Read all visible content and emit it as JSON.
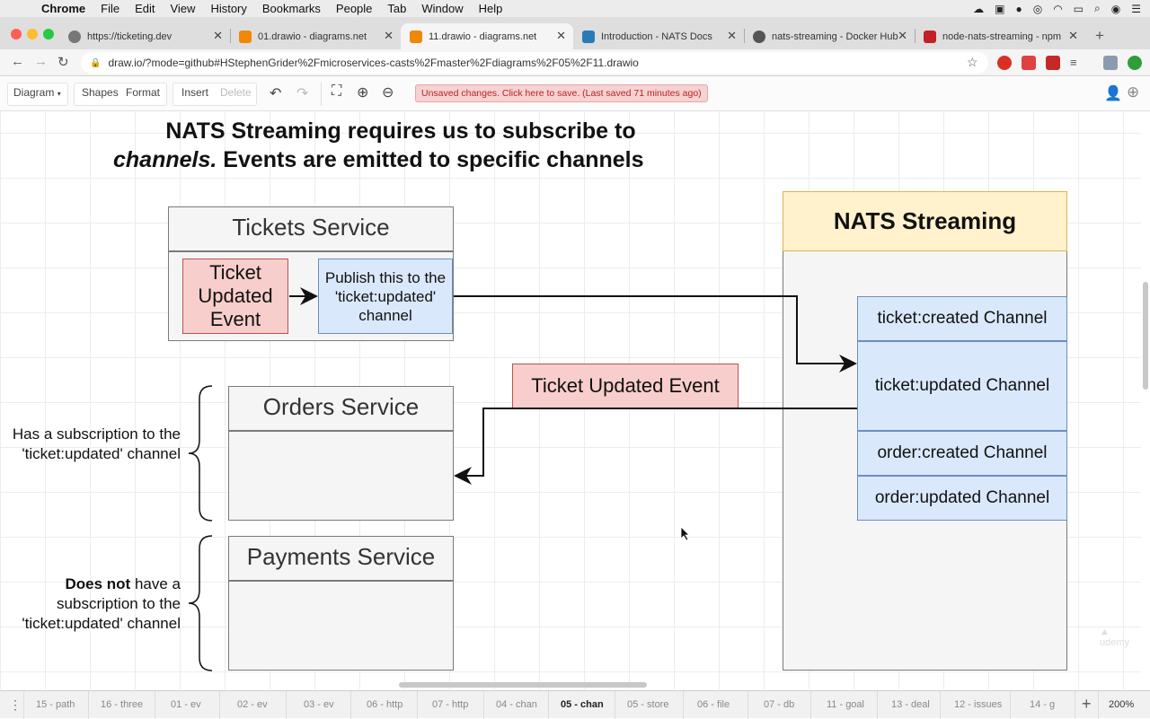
{
  "menubar": {
    "apple": "",
    "items": [
      "Chrome",
      "File",
      "Edit",
      "View",
      "History",
      "Bookmarks",
      "People",
      "Tab",
      "Window",
      "Help"
    ]
  },
  "tabs": [
    {
      "title": "https://ticketing.dev",
      "color": "#666666"
    },
    {
      "title": "01.drawio - diagrams.net",
      "color": "#f08705"
    },
    {
      "title": "11.drawio - diagrams.net",
      "color": "#f08705"
    },
    {
      "title": "Introduction - NATS Docs",
      "color": "#2a7ab8"
    },
    {
      "title": "nats-streaming - Docker Hub",
      "color": "#555555"
    },
    {
      "title": "node-nats-streaming - npm",
      "color": "#c12127"
    }
  ],
  "address": {
    "url": "draw.io/?mode=github#HStephenGrider%2Fmicroservices-casts%2Fmaster%2Fdiagrams%2F05%2F11.drawio"
  },
  "toolbar": {
    "diagram": "Diagram",
    "shapes": "Shapes",
    "format": "Format",
    "insert": "Insert",
    "delete": "Delete",
    "unsaved": "Unsaved changes. Click here to save. (Last saved 71 minutes ago)"
  },
  "diagram": {
    "heading_line1": "NATS Streaming requires us to subscribe to",
    "heading_line2_italic": "channels.",
    "heading_line2_rest": "  Events are emitted to specific channels",
    "tickets_service": {
      "title": "Tickets Service",
      "event": "Ticket Updated Event",
      "publish": "Publish this to the 'ticket:updated' channel"
    },
    "orders_service": {
      "title": "Orders Service"
    },
    "payments_service": {
      "title": "Payments Service"
    },
    "ticket_updated_event": "Ticket Updated Event",
    "nats": {
      "title": "NATS Streaming",
      "channels": [
        "ticket:created Channel",
        "ticket:updated Channel",
        "order:created Channel",
        "order:updated Channel"
      ]
    },
    "orders_note": "Has a subscription to the 'ticket:updated' channel",
    "payments_note_bold": "Does not",
    "payments_note_rest": " have a subscription to the 'ticket:updated' channel"
  },
  "colors": {
    "red_fill": "#f8cecc",
    "red_stroke": "#b85450",
    "blue_fill": "#dae8fc",
    "blue_stroke": "#6c8ebf",
    "yellow_fill": "#fff2cc",
    "yellow_stroke": "#d6b656",
    "gray_fill": "#f5f5f5"
  },
  "page_tabs": [
    "15 - path",
    "16 - three",
    "01 - ev",
    "02 - ev",
    "03 - ev",
    "06 - http",
    "07 - http",
    "04 - chan",
    "05 - chan",
    "05 - store",
    "06 - file",
    "07 - db",
    "11 - goal",
    "13 - deal",
    "12 - issues",
    "14 - g"
  ],
  "active_page_tab": "05 - chan",
  "zoom": "200%"
}
